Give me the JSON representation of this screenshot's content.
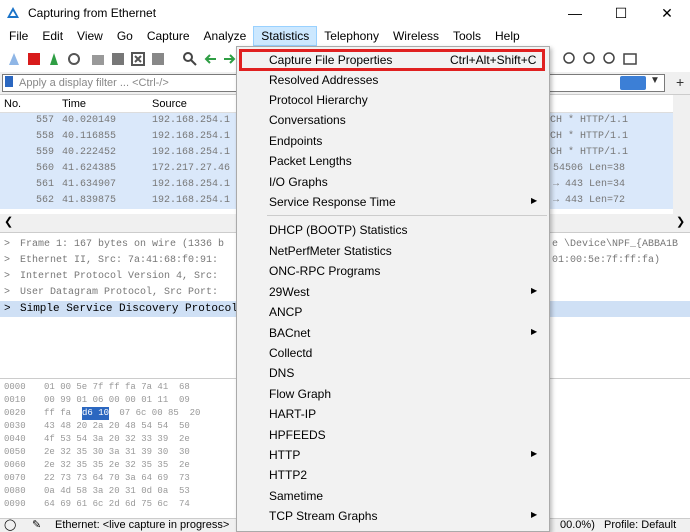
{
  "window": {
    "title": "Capturing from Ethernet"
  },
  "menubar": [
    "File",
    "Edit",
    "View",
    "Go",
    "Capture",
    "Analyze",
    "Statistics",
    "Telephony",
    "Wireless",
    "Tools",
    "Help"
  ],
  "filter": {
    "placeholder": "Apply a display filter ... <Ctrl-/>"
  },
  "packet_list": {
    "headers": {
      "no": "No.",
      "time": "Time",
      "source": "Source"
    },
    "rows": [
      {
        "no": "557",
        "time": "40.020149",
        "src": "192.168.254.1",
        "info": "CH * HTTP/1.1"
      },
      {
        "no": "558",
        "time": "40.116855",
        "src": "192.168.254.1",
        "info": "CH * HTTP/1.1"
      },
      {
        "no": "559",
        "time": "40.222452",
        "src": "192.168.254.1",
        "info": "CH * HTTP/1.1"
      },
      {
        "no": "560",
        "time": "41.624385",
        "src": "172.217.27.46",
        "info": "54506 Len=38"
      },
      {
        "no": "561",
        "time": "41.634907",
        "src": "192.168.254.1",
        "info": "→ 443 Len=34"
      },
      {
        "no": "562",
        "time": "41.839875",
        "src": "192.168.254.1",
        "info": "→ 443 Len=72"
      }
    ]
  },
  "details": {
    "rows": [
      {
        "left": "Frame 1: 167 bytes on wire (1336 b",
        "right": "e \\Device\\NPF_{ABBA1B"
      },
      {
        "left": "Ethernet II, Src: 7a:41:68:f0:91:",
        "right": "01:00:5e:7f:ff:fa)"
      },
      {
        "left": "Internet Protocol Version 4, Src:",
        "right": ""
      },
      {
        "left": "User Datagram Protocol, Src Port:",
        "right": ""
      }
    ],
    "selected": "Simple Service Discovery Protocol"
  },
  "bytes": {
    "rows": [
      {
        "off": "0000",
        "hex": "01 00 5e 7f ff fa 7a 41  68"
      },
      {
        "off": "0010",
        "hex": "00 99 01 06 00 00 01 11  09"
      },
      {
        "off": "0020",
        "hex": "ff fa",
        "sel": "d6 10",
        "rest": " 07 6c 00 85  20"
      },
      {
        "off": "0030",
        "hex": "43 48 20 2a 20 48 54 54  50"
      },
      {
        "off": "0040",
        "hex": "4f 53 54 3a 20 32 33 39  2e"
      },
      {
        "off": "0050",
        "hex": "2e 32 35 30 3a 31 39 30  30"
      },
      {
        "off": "0060",
        "hex": "2e 32 35 35 2e 32 35 35  2e"
      },
      {
        "off": "0070",
        "hex": "22 73 73 64 70 3a 64 69  73"
      },
      {
        "off": "0080",
        "hex": "0a 4d 58 3a 20 31 0d 0a  53"
      },
      {
        "off": "0090",
        "hex": "64 69 61 6c 2d 6d 75 6c  74"
      }
    ]
  },
  "status": {
    "text": "Ethernet: <live capture in progress>",
    "pct": "00.0%)",
    "profile": "Profile: Default"
  },
  "statistics_menu": [
    {
      "label": "Capture File Properties",
      "shortcut": "Ctrl+Alt+Shift+C",
      "submenu": false,
      "highlighted": true
    },
    {
      "label": "Resolved Addresses",
      "submenu": false
    },
    {
      "label": "Protocol Hierarchy",
      "submenu": false
    },
    {
      "label": "Conversations",
      "submenu": false
    },
    {
      "label": "Endpoints",
      "submenu": false
    },
    {
      "label": "Packet Lengths",
      "submenu": false
    },
    {
      "label": "I/O Graphs",
      "submenu": false
    },
    {
      "label": "Service Response Time",
      "submenu": true
    },
    {
      "separator": true
    },
    {
      "label": "DHCP (BOOTP) Statistics",
      "submenu": false
    },
    {
      "label": "NetPerfMeter Statistics",
      "submenu": false
    },
    {
      "label": "ONC-RPC Programs",
      "submenu": false
    },
    {
      "label": "29West",
      "submenu": true
    },
    {
      "label": "ANCP",
      "submenu": false
    },
    {
      "label": "BACnet",
      "submenu": true
    },
    {
      "label": "Collectd",
      "submenu": false
    },
    {
      "label": "DNS",
      "submenu": false
    },
    {
      "label": "Flow Graph",
      "submenu": false
    },
    {
      "label": "HART-IP",
      "submenu": false
    },
    {
      "label": "HPFEEDS",
      "submenu": false
    },
    {
      "label": "HTTP",
      "submenu": true
    },
    {
      "label": "HTTP2",
      "submenu": false
    },
    {
      "label": "Sametime",
      "submenu": false
    },
    {
      "label": "TCP Stream Graphs",
      "submenu": true
    }
  ],
  "colors": {
    "highlight_border": "#e02020",
    "row_bg": "#dae8fa",
    "menu_active": "#cce8ff"
  },
  "icons": [
    "wireshark-fin-icon",
    "minimize-icon",
    "maximize-icon",
    "close-icon",
    "submenu-arrow-icon"
  ]
}
